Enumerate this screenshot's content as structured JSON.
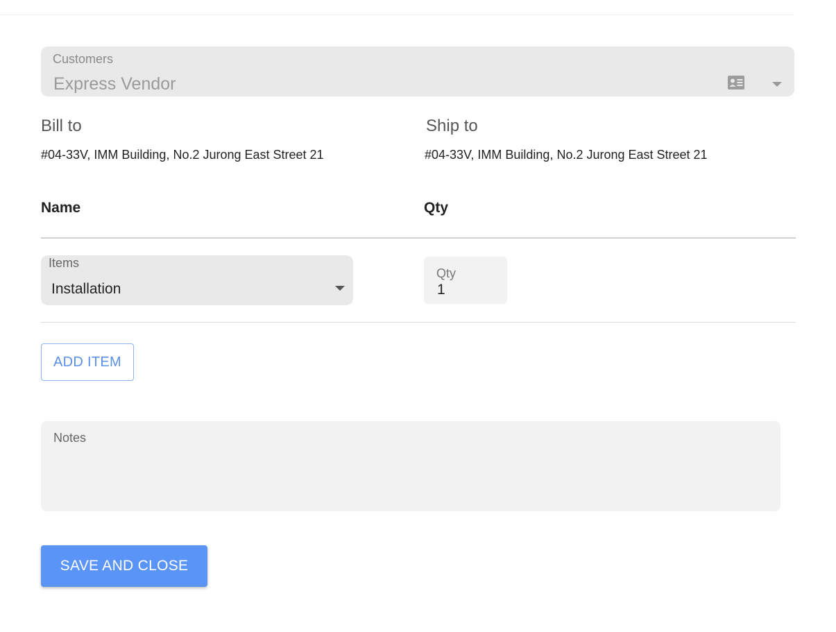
{
  "customer": {
    "label": "Customers",
    "value": "Express Vendor",
    "icons": [
      "contact-card-icon",
      "chevron-down-icon"
    ]
  },
  "bill_to": {
    "title": "Bill to",
    "address": "#04-33V, IMM Building, No.2 Jurong East Street 21"
  },
  "ship_to": {
    "title": "Ship to",
    "address": "#04-33V, IMM Building, No.2 Jurong East Street 21"
  },
  "table": {
    "headers": {
      "name": "Name",
      "qty": "Qty"
    },
    "rows": [
      {
        "item_label": "Items",
        "item_value": "Installation",
        "qty_label": "Qty",
        "qty_value": "1"
      }
    ]
  },
  "actions": {
    "add_item": "ADD ITEM",
    "save_and_close": "SAVE AND CLOSE"
  },
  "notes": {
    "label": "Notes",
    "value": ""
  },
  "colors": {
    "primary": "#5a94f6",
    "outline_button_text": "#5b8fe8",
    "field_background": "#e9e9e9"
  }
}
